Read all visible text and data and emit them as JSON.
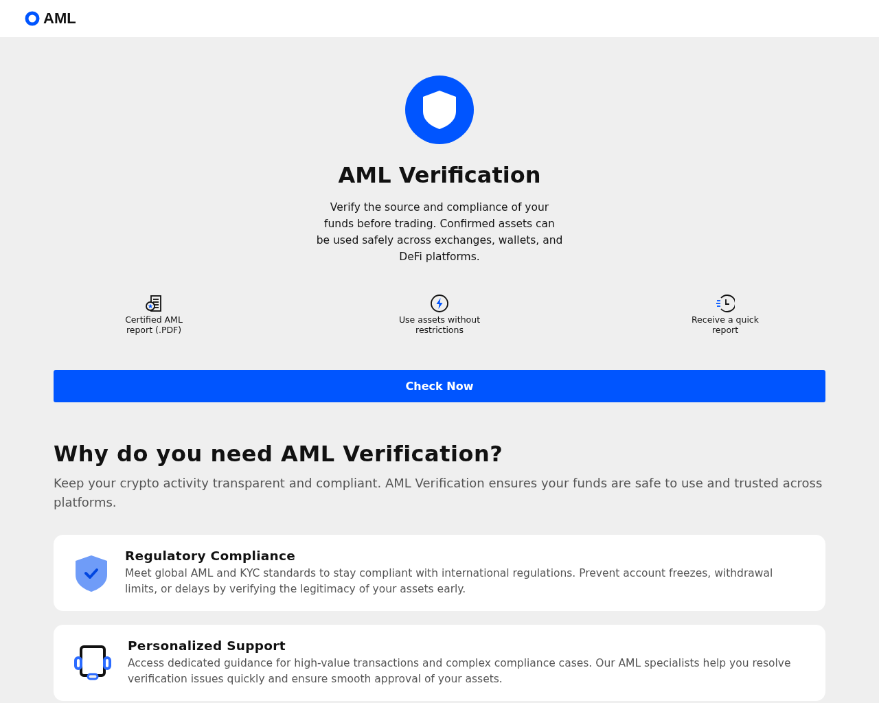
{
  "brand": "AML",
  "hero": {
    "title": "AML Verification",
    "description": "Verify the source and compliance of your funds before trading. Confirmed assets can be used safely across exchanges, wallets, and DeFi platforms."
  },
  "features": [
    {
      "kind": "certificate",
      "label": "Certified AML report (.PDF)"
    },
    {
      "kind": "bolt",
      "label": "Use assets without restrictions"
    },
    {
      "kind": "clock",
      "label": "Receive a quick report"
    }
  ],
  "cta": "Check Now",
  "why": {
    "title": "Why do you need AML Verification?",
    "subtitle": "Keep your crypto activity transparent and compliant. AML Verification ensures your funds are safe to use and trusted across platforms."
  },
  "cards": [
    {
      "kind": "shield",
      "title": "Regulatory Compliance",
      "text": "Meet global AML and KYC standards to stay compliant with international regulations. Prevent account freezes, withdrawal limits, or delays by verifying the legitimacy of your assets early."
    },
    {
      "kind": "headset",
      "title": "Personalized Support",
      "text": "Access dedicated guidance for high-value transactions and complex compliance cases. Our AML specialists help you resolve verification issues quickly and ensure smooth approval of your assets."
    }
  ]
}
